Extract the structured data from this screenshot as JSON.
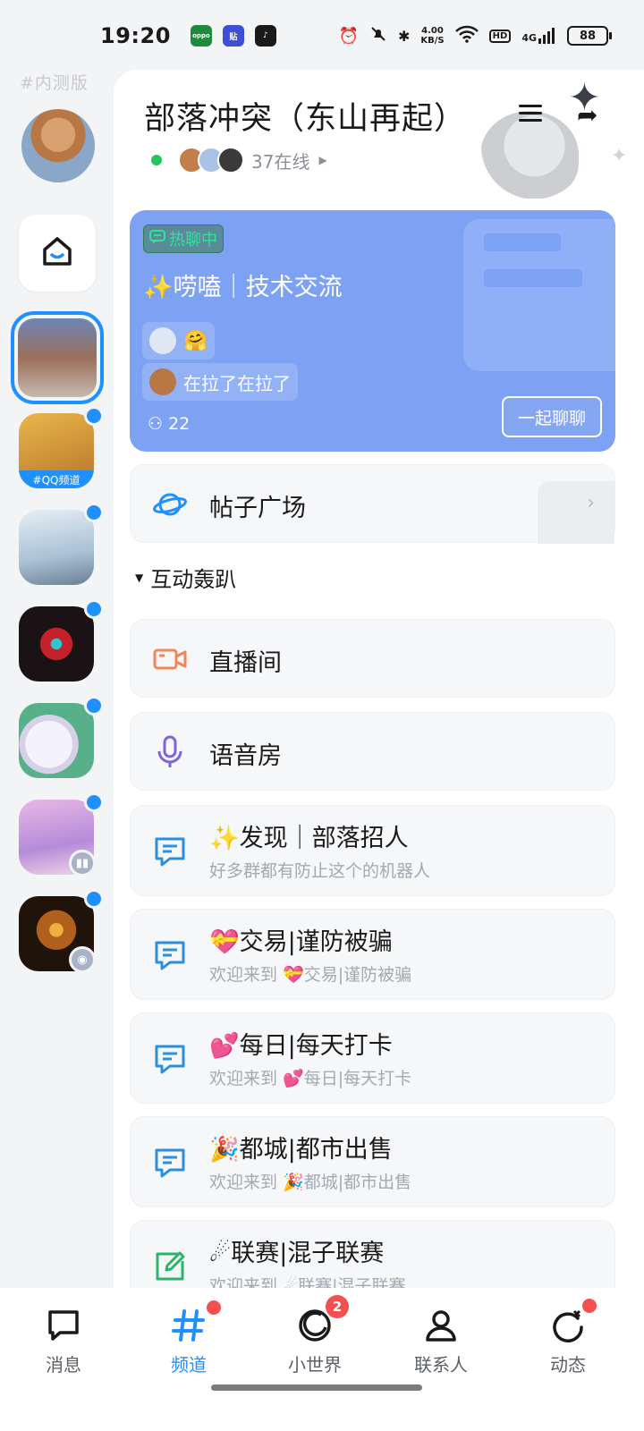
{
  "status": {
    "time": "19:20",
    "apps": [
      {
        "name": "oppo",
        "color": "#1f8a3b",
        "label": "oppo"
      },
      {
        "name": "tieba",
        "color": "#3d4fd6",
        "label": "贴"
      },
      {
        "name": "tiktok",
        "color": "#1a1a1a",
        "label": "♪"
      }
    ],
    "net_speed": "4.00",
    "net_unit": "KB/S",
    "hd": "HD",
    "network": "4G",
    "battery": "88"
  },
  "rail": {
    "beta_label": "#内测版",
    "items": [
      {
        "name": "coc-qq-channel",
        "badge": "#QQ频道",
        "color": "#e0a33a"
      },
      {
        "name": "fantasy-island",
        "color": "#b9cfe0"
      },
      {
        "name": "dark-game",
        "color": "#2a1a1f"
      },
      {
        "name": "anime-sticker",
        "color": "#e9e6f2"
      },
      {
        "name": "anime-girl",
        "color": "#d9b6e6"
      },
      {
        "name": "warrior",
        "color": "#3a2410"
      }
    ]
  },
  "header": {
    "title": "部落冲突（东山再起）",
    "online_text": "37在线"
  },
  "hot_chat": {
    "tag": "热聊中",
    "title": "✨唠嗑｜技术交流",
    "message": "在拉了在拉了",
    "member_count": "22",
    "join_button": "一起聊聊",
    "accent": "#7ea2f3"
  },
  "square": {
    "label": "帖子广场"
  },
  "section": {
    "label": "互动轰趴"
  },
  "simple_rooms": [
    {
      "label": "直播间",
      "icon": "live-video-icon"
    },
    {
      "label": "语音房",
      "icon": "microphone-icon"
    }
  ],
  "channels": [
    {
      "label": "✨发现｜部落招人",
      "sub": "好多群都有防止这个的机器人",
      "icon": "chat-icon"
    },
    {
      "label": "💝交易|谨防被骗",
      "sub": "欢迎来到 💝交易|谨防被骗",
      "icon": "chat-icon"
    },
    {
      "label": "💕每日|每天打卡",
      "sub": "欢迎来到 💕每日|每天打卡",
      "icon": "chat-icon"
    },
    {
      "label": "🎉都城|都市出售",
      "sub": "欢迎来到 🎉都城|都市出售",
      "icon": "chat-icon"
    },
    {
      "label": "☄联赛|混子联赛",
      "sub": "欢迎来到 ☄联赛|混子联赛",
      "icon": "post-edit-icon"
    }
  ],
  "tabs": [
    {
      "label": "消息",
      "icon": "message-icon"
    },
    {
      "label": "频道",
      "icon": "hashtag-icon",
      "active": true
    },
    {
      "label": "小世界",
      "icon": "small-world-icon",
      "badge": "2"
    },
    {
      "label": "联系人",
      "icon": "contacts-icon"
    },
    {
      "label": "动态",
      "icon": "dynamic-icon"
    }
  ],
  "colors": {
    "accent": "#1e90ff",
    "badge": "#f45050",
    "online": "#22c55e"
  }
}
